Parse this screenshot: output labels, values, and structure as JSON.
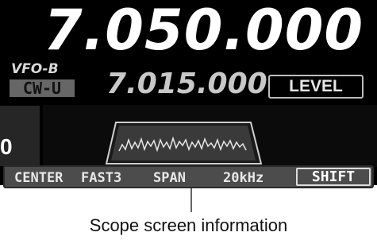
{
  "display": {
    "main_frequency": "7.050.000",
    "vfo": "VFO-B",
    "mode": "CW-U",
    "sub_frequency": "7.015.000",
    "level_label": "LEVEL",
    "left_digit": "0"
  },
  "status_bar": {
    "mode": "CENTER",
    "speed": "FAST3",
    "span_label": "SPAN",
    "span_value": "20kHz",
    "shift_label": "SHIFT"
  },
  "caption": "Scope screen information"
}
